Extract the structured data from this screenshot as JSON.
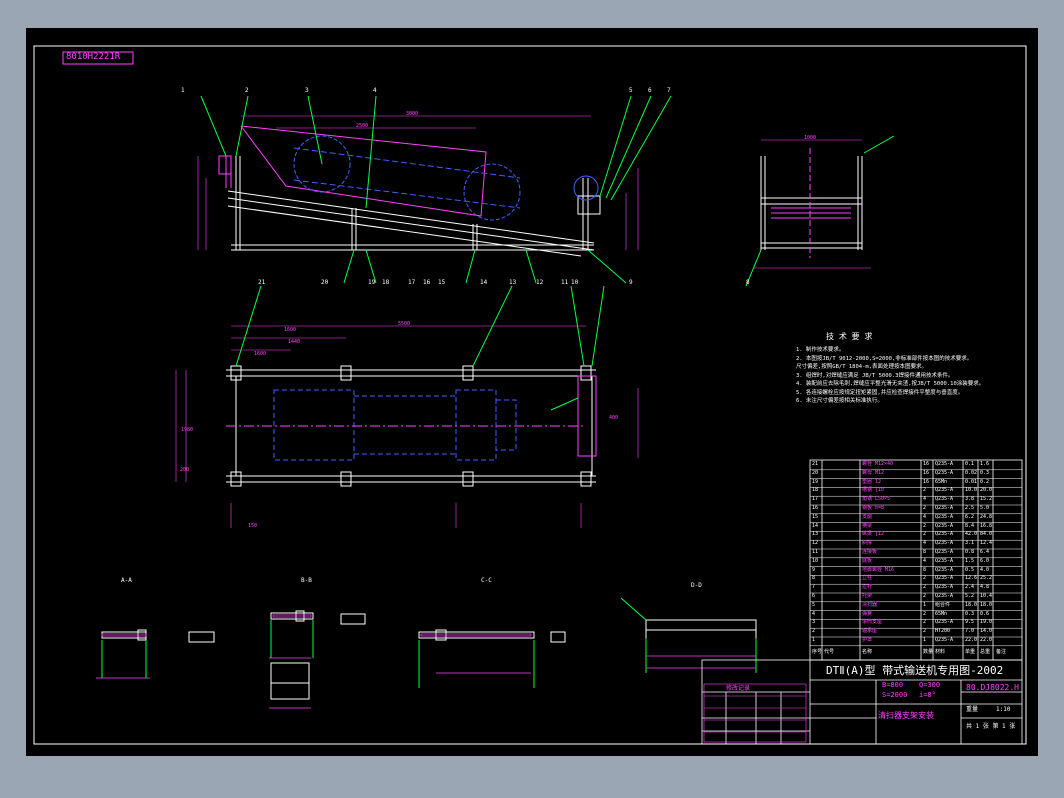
{
  "drawing_code": "8010H2221R",
  "drawing_code_title": "80.DJ8022.H",
  "title_line1": "DTⅡ(A)型 带式输送机专用图-2002",
  "title_line2": "B=800",
  "title_line3": "S=2000",
  "title_line4": "Q=300",
  "title_line5": "i=8°",
  "title_sub": "清扫器支架安装",
  "notes_heading": "技 术 要 求",
  "notes": [
    "1. 制作技术要求。",
    "2. 本图按JB/T 9012-2000,S=2000,非标准部件按本图的技术要求。",
    "   尺寸偏差,按照GB/T 1804-m,表面处理按本图要求。",
    "3. 组焊时,对焊缝应满足 JB/T 5000.3焊接件通用技术条件。",
    "4. 装配前应去除毛刺,焊缝应平整光滑无夹渣,按JB/T 5000.10涂装要求。",
    "5. 各连接螺栓应按规定扭矩紧固,并应检查焊接件平整度与垂直度。",
    "6. 未注尺寸偏差按相关标准执行。"
  ],
  "section_labels": [
    "A-A",
    "B-B",
    "C-C",
    "D-D"
  ],
  "part_numbers_top": [
    "1",
    "2",
    "3",
    "4",
    "5",
    "6",
    "7"
  ],
  "part_numbers_bottom": [
    "21",
    "20",
    "19",
    "18",
    "17",
    "16",
    "15",
    "14",
    "13",
    "12",
    "11",
    "10",
    "9",
    "8"
  ],
  "dims": [
    "3000",
    "2500",
    "1600",
    "1440",
    "1600",
    "1980",
    "5500",
    "L=5500",
    "1000",
    "400",
    "200",
    "150"
  ],
  "bom_header": [
    "序号",
    "代号",
    "名称",
    "数量",
    "材料",
    "单重",
    "总重",
    "备注"
  ],
  "bom_rows": [
    [
      "21",
      "",
      "螺栓 M12×40",
      "16",
      "Q235-A",
      "0.1",
      "1.6"
    ],
    [
      "20",
      "",
      "螺母 M12",
      "16",
      "Q235-A",
      "0.02",
      "0.3"
    ],
    [
      "19",
      "",
      "垫圈 12",
      "16",
      "65Mn",
      "0.01",
      "0.2"
    ],
    [
      "18",
      "",
      "槽钢 [10",
      "2",
      "Q235-A",
      "10.0",
      "20.0"
    ],
    [
      "17",
      "",
      "角钢 L50×5",
      "4",
      "Q235-A",
      "3.8",
      "15.2"
    ],
    [
      "16",
      "",
      "钢板 δ=8",
      "2",
      "Q235-A",
      "2.5",
      "5.0"
    ],
    [
      "15",
      "",
      "支腿",
      "4",
      "Q235-A",
      "6.2",
      "24.8"
    ],
    [
      "14",
      "",
      "横梁",
      "2",
      "Q235-A",
      "8.4",
      "16.8"
    ],
    [
      "13",
      "",
      "纵梁 [12",
      "2",
      "Q235-A",
      "42.0",
      "84.0"
    ],
    [
      "12",
      "",
      "斜撑",
      "4",
      "Q235-A",
      "3.1",
      "12.4"
    ],
    [
      "11",
      "",
      "连接板",
      "8",
      "Q235-A",
      "0.8",
      "6.4"
    ],
    [
      "10",
      "",
      "底板",
      "4",
      "Q235-A",
      "1.5",
      "6.0"
    ],
    [
      "9",
      "",
      "地脚螺栓 M16",
      "8",
      "Q235-A",
      "0.5",
      "4.0"
    ],
    [
      "8",
      "",
      "立柱",
      "2",
      "Q235-A",
      "12.6",
      "25.2"
    ],
    [
      "7",
      "",
      "拉杆",
      "2",
      "Q235-A",
      "2.4",
      "4.8"
    ],
    [
      "6",
      "",
      "托架",
      "2",
      "Q235-A",
      "5.2",
      "10.4"
    ],
    [
      "5",
      "",
      "清扫器",
      "1",
      "组合件",
      "18.0",
      "18.0"
    ],
    [
      "4",
      "",
      "弹簧",
      "2",
      "65Mn",
      "0.3",
      "0.6"
    ],
    [
      "3",
      "",
      "滚筒支座",
      "2",
      "Q235-A",
      "9.5",
      "19.0"
    ],
    [
      "2",
      "",
      "轴承座",
      "2",
      "HT200",
      "7.0",
      "14.0"
    ],
    [
      "1",
      "",
      "护罩",
      "1",
      "Q235-A",
      "22.0",
      "22.0"
    ]
  ],
  "revision_heading": "修改记录",
  "scale_label": "1:10",
  "sheet_label": "共 1 张 第 1 张",
  "mass_label": "重量",
  "colors": {
    "frame": "#ffffff",
    "geometry": "#00ff40",
    "magenta": "#ff40ff",
    "blue": "#4060ff",
    "cyan": "#00e0e0",
    "yellow": "#ffff00",
    "red": "#ff2020"
  }
}
